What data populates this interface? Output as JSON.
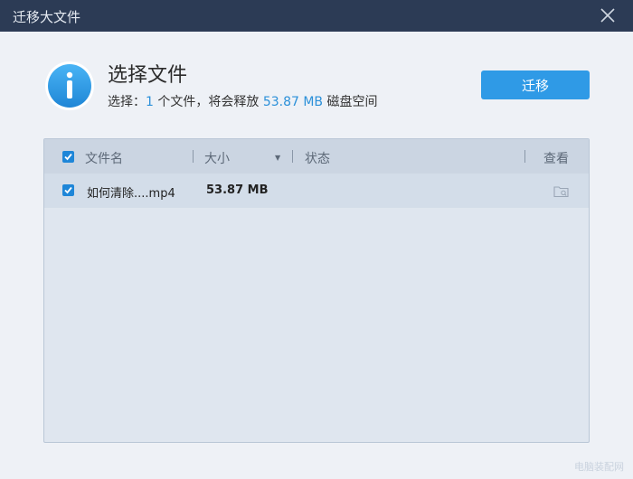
{
  "window": {
    "title": "迁移大文件"
  },
  "header": {
    "heading": "选择文件",
    "summary": {
      "prefix": "选择：",
      "count": "1",
      "mid": "个文件，将会释放",
      "size": "53.87 MB",
      "suffix": "磁盘空间"
    },
    "migrate_button": "迁移"
  },
  "table": {
    "columns": {
      "name": "文件名",
      "size": "大小",
      "status": "状态",
      "view": "查看"
    },
    "rows": [
      {
        "name": "如何清除....mp4",
        "size": "53.87 MB",
        "status": "",
        "checked": true
      }
    ]
  },
  "watermark": "电脑装配网",
  "colors": {
    "titlebar": "#2c3b55",
    "accent": "#2f9ae6",
    "highlight": "#2b90d9"
  },
  "icons": [
    "info-icon",
    "close-icon",
    "checkbox-checked-icon",
    "sort-down-icon",
    "folder-view-icon"
  ]
}
